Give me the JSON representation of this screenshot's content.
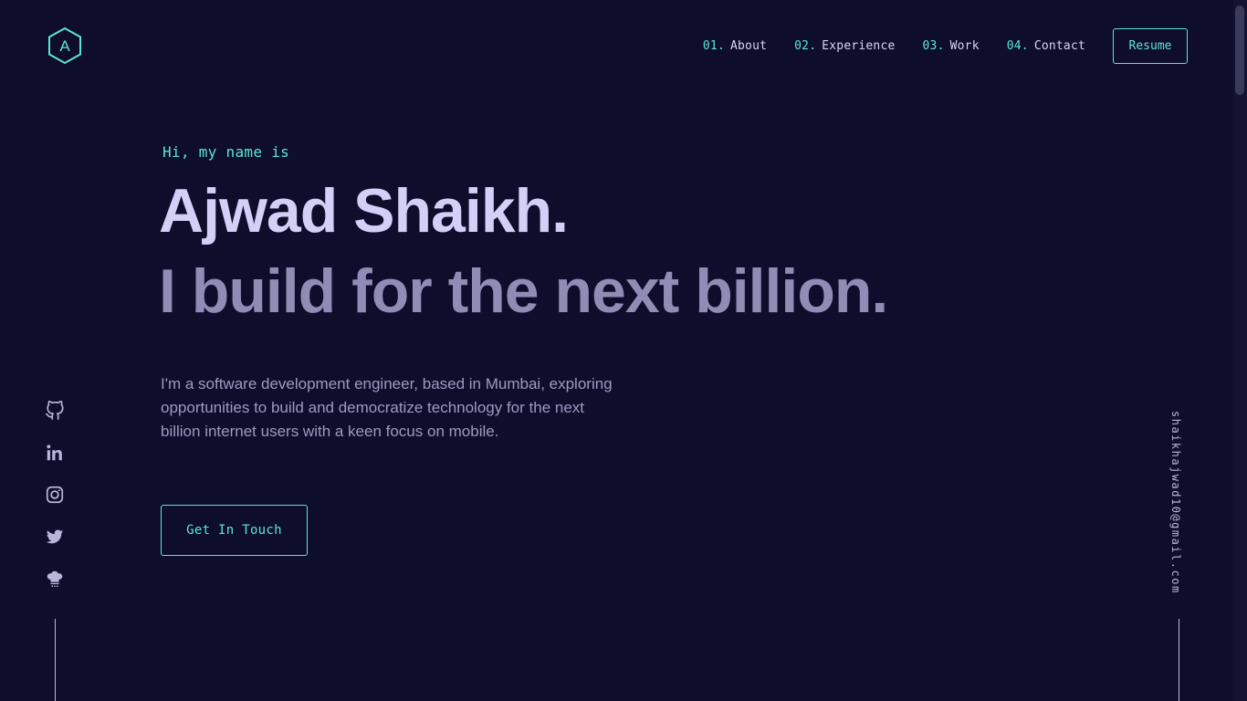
{
  "logo": {
    "letter": "A",
    "icon": "hexagon-logo-icon",
    "color": "#5ce5cf"
  },
  "nav": {
    "items": [
      {
        "number": "01.",
        "label": "About"
      },
      {
        "number": "02.",
        "label": "Experience"
      },
      {
        "number": "03.",
        "label": "Work"
      },
      {
        "number": "04.",
        "label": "Contact"
      }
    ],
    "resume_label": "Resume"
  },
  "hero": {
    "greeting": "Hi, my name is",
    "name": "Ajwad Shaikh.",
    "tagline": "I build for the next billion.",
    "bio": "I'm a software development engineer, based in Mumbai, exploring opportunities to build and democratize technology for the next billion internet users with a keen focus on mobile.",
    "cta_label": "Get In Touch"
  },
  "social": [
    {
      "icon": "github-icon"
    },
    {
      "icon": "linkedin-icon"
    },
    {
      "icon": "instagram-icon"
    },
    {
      "icon": "twitter-icon"
    },
    {
      "icon": "chef-hat-icon"
    }
  ],
  "email": "shaikhajwad10@gmail.com",
  "colors": {
    "background": "#0e0e2c",
    "accent": "#5ce5cf",
    "heading": "#d3d0f8",
    "subheading": "#8f8cb5",
    "body_text": "#9c9ac0"
  }
}
